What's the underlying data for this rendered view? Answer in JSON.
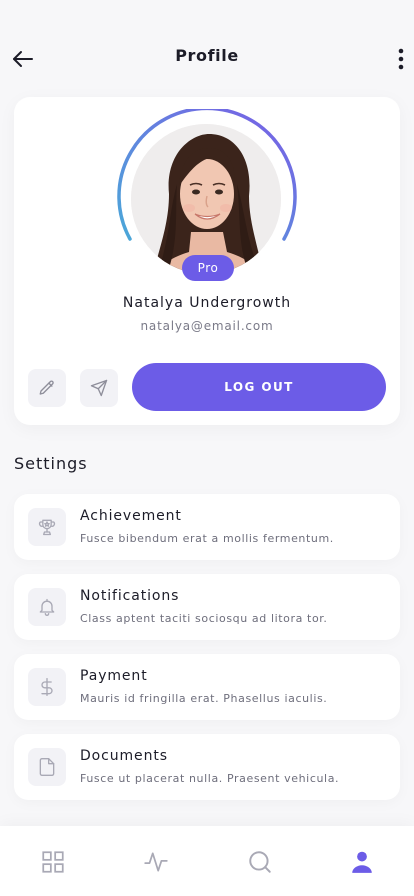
{
  "header": {
    "title": "Profile",
    "back_icon": "arrow-left-icon",
    "more_icon": "more-vertical-icon"
  },
  "profile": {
    "name": "Natalya Undergrowth",
    "email": "natalya@email.com",
    "badge": "Pro",
    "ring_gradient": [
      "#4aa8d8",
      "#7b5ce6"
    ],
    "actions": {
      "edit_icon": "pencil-icon",
      "send_icon": "send-icon",
      "logout_label": "LOG OUT"
    }
  },
  "settings": {
    "title": "Settings",
    "items": [
      {
        "icon": "trophy-icon",
        "title": "Achievement",
        "subtitle": "Fusce bibendum erat a mollis fermentum."
      },
      {
        "icon": "bell-icon",
        "title": "Notifications",
        "subtitle": "Class aptent taciti sociosqu ad litora tor."
      },
      {
        "icon": "dollar-icon",
        "title": "Payment",
        "subtitle": "Mauris id fringilla erat. Phasellus iaculis."
      },
      {
        "icon": "document-icon",
        "title": "Documents",
        "subtitle": "Fusce ut placerat nulla. Praesent vehicula."
      }
    ]
  },
  "bottom_nav": {
    "items": [
      {
        "icon": "grid-icon",
        "active": false
      },
      {
        "icon": "activity-icon",
        "active": false
      },
      {
        "icon": "search-icon",
        "active": false
      },
      {
        "icon": "user-icon",
        "active": true
      }
    ]
  },
  "colors": {
    "accent": "#6c5ce7",
    "background": "#f7f7f9",
    "card": "#ffffff",
    "muted_icon": "#a9a9b5"
  }
}
